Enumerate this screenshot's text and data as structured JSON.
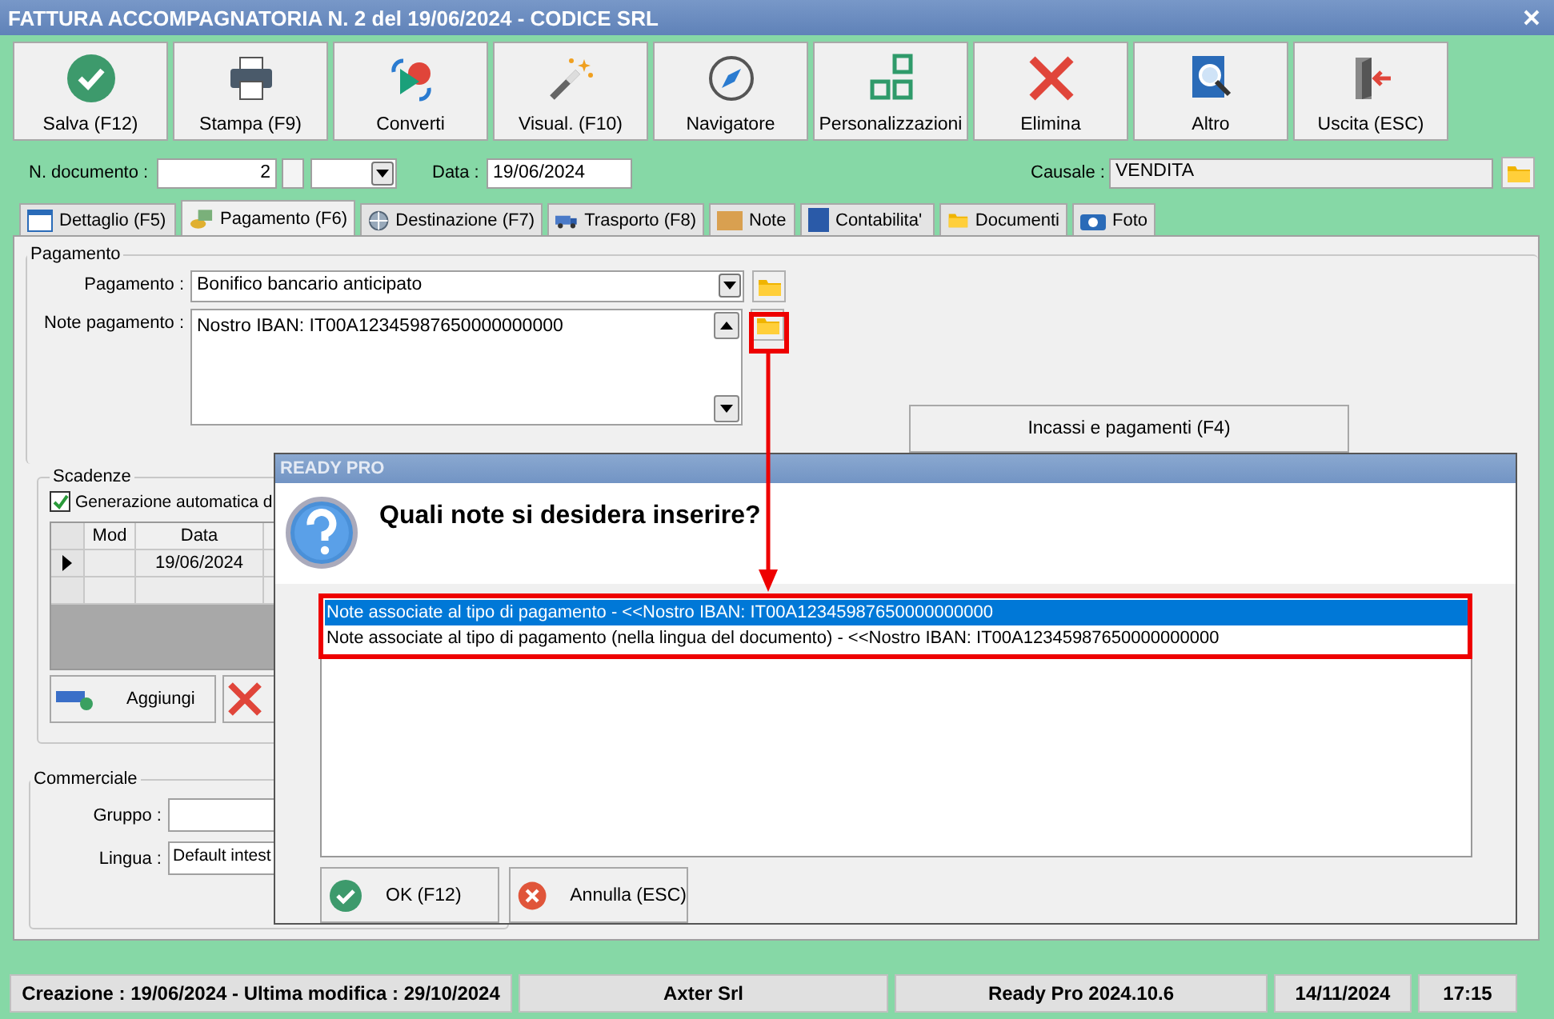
{
  "window": {
    "title": "FATTURA ACCOMPAGNATORIA N. 2 del 19/06/2024 - CODICE SRL"
  },
  "toolbar": [
    {
      "label": "Salva (F12)"
    },
    {
      "label": "Stampa (F9)"
    },
    {
      "label": "Converti"
    },
    {
      "label": "Visual. (F10)"
    },
    {
      "label": "Navigatore"
    },
    {
      "label": "Personalizzazioni"
    },
    {
      "label": "Elimina"
    },
    {
      "label": "Altro"
    },
    {
      "label": "Uscita (ESC)"
    }
  ],
  "header": {
    "doc_number_label": "N. documento :",
    "doc_number": "2",
    "date_label": "Data :",
    "date": "19/06/2024",
    "causale_label": "Causale :",
    "causale": "VENDITA"
  },
  "tabs": [
    {
      "label": "Dettaglio (F5)",
      "selected": false
    },
    {
      "label": "Pagamento (F6)",
      "selected": true
    },
    {
      "label": "Destinazione (F7)",
      "selected": false
    },
    {
      "label": "Trasporto (F8)",
      "selected": false
    },
    {
      "label": "Note",
      "selected": false
    },
    {
      "label": "Contabilita'",
      "selected": false
    },
    {
      "label": "Documenti",
      "selected": false
    },
    {
      "label": "Foto",
      "selected": false
    }
  ],
  "payment_group": {
    "title": "Pagamento",
    "payment_label": "Pagamento :",
    "payment": "Bonifico bancario anticipato",
    "notes_label": "Note pagamento :",
    "notes": "Nostro IBAN: IT00A12345987650000000000",
    "incassi_button": "Incassi e pagamenti (F4)"
  },
  "scadenze": {
    "title": "Scadenze",
    "auto_label": "Generazione automatica d",
    "auto_checked": true,
    "columns": [
      "Mod",
      "Data"
    ],
    "rows": [
      {
        "current": true,
        "data": "19/06/2024"
      },
      {
        "current": false
      }
    ],
    "add_button": "Aggiungi"
  },
  "commerciale": {
    "title": "Commerciale",
    "group_label": "Gruppo :",
    "language_label": "Lingua :",
    "language": "Default intest"
  },
  "dialog": {
    "title": "READY PRO",
    "question": "Quali note si desidera inserire?",
    "options": [
      {
        "label": "Note associate al tipo di pagamento - <<Nostro IBAN: IT00A12345987650000000000",
        "selected": true
      },
      {
        "label": "Note associate al tipo di pagamento (nella lingua del documento) - <<Nostro IBAN: IT00A12345987650000000000",
        "selected": false
      }
    ],
    "buttons": [
      {
        "label": "OK (F12)"
      },
      {
        "label": "Annulla (ESC)"
      }
    ]
  },
  "status_bar": [
    "Creazione : 19/06/2024 - Ultima modifica : 29/10/2024",
    "Axter Srl",
    "Ready Pro 2024.10.6",
    "14/11/2024",
    "17:15"
  ]
}
